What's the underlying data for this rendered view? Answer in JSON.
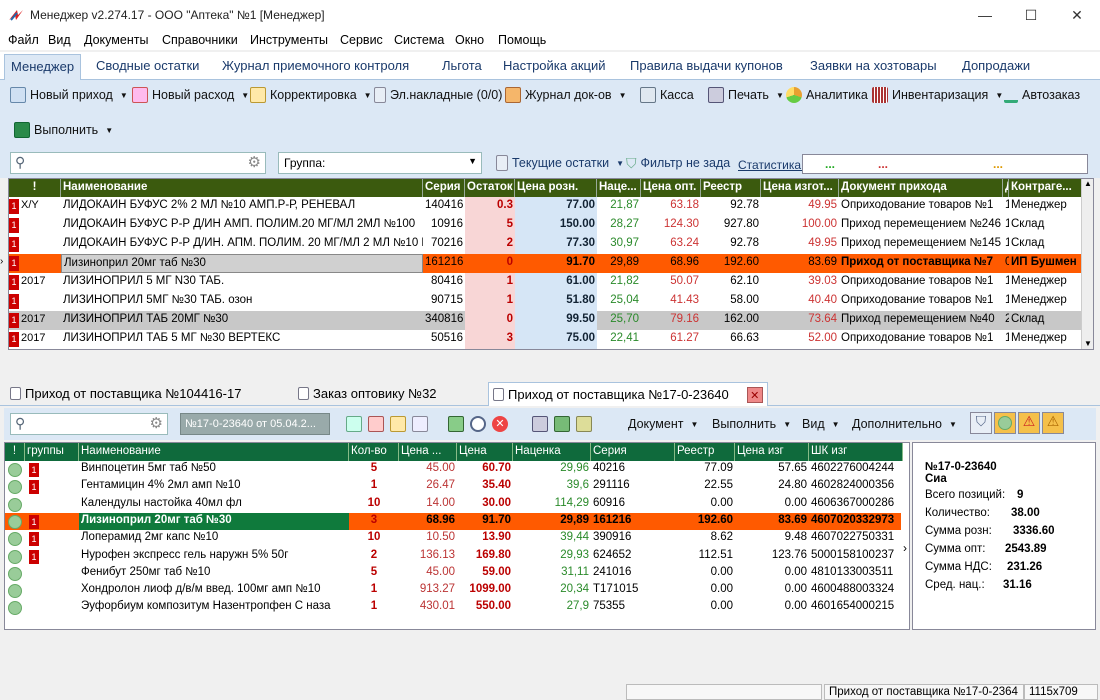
{
  "window": {
    "title": "Менеджер v2.274.17 - ООО \"Аптека\" №1 [Менеджер]"
  },
  "menu": [
    "Файл",
    "Вид",
    "Документы",
    "Справочники",
    "Инструменты",
    "Сервис",
    "Система",
    "Окно",
    "Помощь"
  ],
  "tabs": [
    "Менеджер",
    "Сводные остатки",
    "Журнал приемочного контроля",
    "Льгота",
    "Настройка акций",
    "Правила выдачи купонов",
    "Заявки на хозтовары",
    "Допродажи"
  ],
  "toolbar": {
    "new_income": "Новый приход",
    "new_expense": "Новый расход",
    "correction": "Корректировка",
    "e_invoices": "Эл.накладные (0/0)",
    "docs_journal": "Журнал док-ов",
    "cashier": "Касса",
    "print": "Печать",
    "analytics": "Аналитика",
    "inventory": "Инвентаризация",
    "autoorder": "Автозаказ",
    "execute": "Выполнить"
  },
  "filter": {
    "group_placeholder": "Группа:",
    "current_stock": "Текущие остатки",
    "filter_label": "Фильтр не зада",
    "stats_label": "Статистика:",
    "stats_dots": [
      "...",
      "...",
      "..."
    ]
  },
  "grid1": {
    "headers": [
      "!",
      "Наименование",
      "Серия",
      "Остаток",
      "Цена розн.",
      "Наце...",
      "Цена опт.",
      "Реестр",
      "Цена изгот...",
      "Документ прихода",
      "Д",
      "Контраге..."
    ],
    "rows": [
      {
        "mark": "1",
        "yr": "X/Y",
        "name": "ЛИДОКАИН БУФУС 2% 2 МЛ №10 АМП.Р-Р, РЕНЕВАЛ",
        "series": "140416",
        "stock": "0.3",
        "retail": "77.00",
        "markup": "21,87",
        "opt": "63.18",
        "reg": "92.78",
        "mfr": "49.95",
        "doc": "Оприходование товаров №1",
        "d": "1",
        "agent": "Менеджер"
      },
      {
        "mark": "1",
        "yr": "",
        "name": "ЛИДОКАИН БУФУС Р-Р Д/ИН АМП. ПОЛИМ.20 МГ/МЛ 2МЛ №100",
        "series": "10916",
        "stock": "5",
        "retail": "150.00",
        "markup": "28,27",
        "opt": "124.30",
        "reg": "927.80",
        "mfr": "100.00",
        "doc": "Приход перемещением №246",
        "d": "1",
        "agent": "Склад"
      },
      {
        "mark": "1",
        "yr": "",
        "name": "ЛИДОКАИН БУФУС Р-Р Д/ИН. АПМ. ПОЛИМ. 20 МГ/МЛ 2 МЛ №10 REN",
        "series": "70216",
        "stock": "2",
        "retail": "77.30",
        "markup": "30,97",
        "opt": "63.24",
        "reg": "92.78",
        "mfr": "49.95",
        "doc": "Приход перемещением №145",
        "d": "1",
        "agent": "Склад"
      },
      {
        "mark": "1",
        "yr": "",
        "name": "Лизиноприл 20мг таб №30",
        "series": "161216",
        "stock": "0",
        "retail": "91.70",
        "markup": "29,89",
        "opt": "68.96",
        "reg": "192.60",
        "mfr": "83.69",
        "doc": "Приход от поставщика №7",
        "d": "0",
        "agent": "ИП Бушмен"
      },
      {
        "mark": "1",
        "yr": "2017",
        "name": "ЛИЗИНОПРИЛ 5 МГ N30 ТАБ.",
        "series": "80416",
        "stock": "1",
        "retail": "61.00",
        "markup": "21,82",
        "opt": "50.07",
        "reg": "62.10",
        "mfr": "39.03",
        "doc": "Оприходование товаров №1",
        "d": "1",
        "agent": "Менеджер"
      },
      {
        "mark": "1",
        "yr": "",
        "name": "ЛИЗИНОПРИЛ 5МГ №30 ТАБ. озон",
        "series": "90715",
        "stock": "1",
        "retail": "51.80",
        "markup": "25,04",
        "opt": "41.43",
        "reg": "58.00",
        "mfr": "40.40",
        "doc": "Оприходование товаров №1",
        "d": "1",
        "agent": "Менеджер"
      },
      {
        "mark": "1",
        "yr": "2017",
        "name": "ЛИЗИНОПРИЛ ТАБ 20МГ №30",
        "series": "340816",
        "stock": "0",
        "retail": "99.50",
        "markup": "25,70",
        "opt": "79.16",
        "reg": "162.00",
        "mfr": "73.64",
        "doc": "Приход перемещением №40",
        "d": "2",
        "agent": "Склад"
      },
      {
        "mark": "1",
        "yr": "2017",
        "name": "ЛИЗИНОПРИЛ ТАБ 5 МГ №30 ВЕРТЕКС",
        "series": "50516",
        "stock": "3",
        "retail": "75.00",
        "markup": "22,41",
        "opt": "61.27",
        "reg": "66.63",
        "mfr": "52.00",
        "doc": "Оприходование товаров №1",
        "d": "1",
        "agent": "Менеджер"
      }
    ]
  },
  "doctabs": [
    "Приход от поставщика №104416-17",
    "Заказ оптовику №32",
    "Приход от поставщика №17-0-23640"
  ],
  "lowtb": {
    "doc_field": "№17-0-23640 от 05.04.2...",
    "document": "Документ",
    "execute": "Выполнить",
    "view": "Вид",
    "additional": "Дополнительно"
  },
  "grid2": {
    "headers": [
      "!",
      "группы",
      "Наименование",
      "Кол-во",
      "Цена ...",
      "Цена",
      "Наценка",
      "Серия",
      "Реестр",
      "Цена изг",
      "ШК изг"
    ],
    "rows": [
      {
        "grp": "1",
        "name": "Винпоцетин 5мг таб №50",
        "qty": "5",
        "price_in": "45.00",
        "price": "60.70",
        "markup": "29,96",
        "series": "40216",
        "reg": "77.09",
        "mfr": "57.65",
        "barcode": "4602276004244"
      },
      {
        "grp": "1",
        "name": "Гентамицин 4% 2мл амп №10",
        "qty": "1",
        "price_in": "26.47",
        "price": "35.40",
        "markup": "39,6",
        "series": "291116",
        "reg": "22.55",
        "mfr": "24.80",
        "barcode": "4602824000356"
      },
      {
        "grp": "",
        "name": "Календулы настойка 40мл фл",
        "qty": "10",
        "price_in": "14.00",
        "price": "30.00",
        "markup": "114,29",
        "series": "60916",
        "reg": "0.00",
        "mfr": "0.00",
        "barcode": "4606367000286"
      },
      {
        "grp": "1",
        "name": "Лизиноприл 20мг таб №30",
        "qty": "3",
        "price_in": "68.96",
        "price": "91.70",
        "markup": "29,89",
        "series": "161216",
        "reg": "192.60",
        "mfr": "83.69",
        "barcode": "4607020332973"
      },
      {
        "grp": "1",
        "name": "Лоперамид 2мг капс №10",
        "qty": "10",
        "price_in": "10.50",
        "price": "13.90",
        "markup": "39,44",
        "series": "390916",
        "reg": "8.62",
        "mfr": "9.48",
        "barcode": "4607022750331"
      },
      {
        "grp": "1",
        "name": "Нурофен экспресс гель наружн 5% 50г",
        "qty": "2",
        "price_in": "136.13",
        "price": "169.80",
        "markup": "29,93",
        "series": "624652",
        "reg": "112.51",
        "mfr": "123.76",
        "barcode": "5000158100237"
      },
      {
        "grp": "",
        "name": "Фенибут 250мг таб №10",
        "qty": "5",
        "price_in": "45.00",
        "price": "59.00",
        "markup": "31,11",
        "series": "241016",
        "reg": "0.00",
        "mfr": "0.00",
        "barcode": "4810133003511"
      },
      {
        "grp": "",
        "name": "Хондролон лиоф д/в/м введ. 100мг амп №10",
        "qty": "1",
        "price_in": "913.27",
        "price": "1099.00",
        "markup": "20,34",
        "series": "T171015",
        "reg": "0.00",
        "mfr": "0.00",
        "barcode": "4600488003324"
      },
      {
        "grp": "",
        "name": "Эуфорбиум композитум Назентропфен С наза",
        "qty": "1",
        "price_in": "430.01",
        "price": "550.00",
        "markup": "27,9",
        "series": "75355",
        "reg": "0.00",
        "mfr": "0.00",
        "barcode": "4601654000215"
      }
    ]
  },
  "summary": {
    "doc": "№17-0-23640",
    "agent": "Сиа",
    "items_label": "Всего позиций:",
    "items": "9",
    "qty_label": "Количество:",
    "qty": "38.00",
    "retail_label": "Сумма розн:",
    "retail": "3336.60",
    "opt_label": "Сумма опт:",
    "opt": "2543.89",
    "vat_label": "Сумма НДС:",
    "vat": "231.26",
    "avg_label": "Сред. нац.:",
    "avg": "31.16"
  },
  "status": {
    "doc": "Приход от поставщика №17-0-2364",
    "size": "1115x709"
  },
  "colors": {
    "header_dark": "#3b5a0e",
    "header_green": "#0f6a3c",
    "highlight": "#ff5a00",
    "toolbar_bg": "#dce8f5"
  }
}
